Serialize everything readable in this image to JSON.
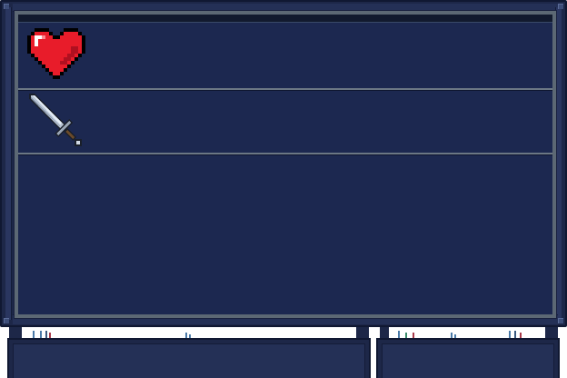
{
  "panel": {
    "rows": [
      {
        "icon": "heart-icon",
        "color": "#e81c2a"
      },
      {
        "icon": "sword-icon",
        "color": "#b8c4d4"
      },
      {
        "icon": "",
        "color": ""
      }
    ]
  },
  "colors": {
    "panel_bg": "#1c2850",
    "frame": "#1d2748",
    "border_steel": "#5c6874",
    "heart_red": "#e81c2a",
    "sword_steel": "#b8c4d4"
  },
  "slots": [
    {
      "name": "slot-left"
    },
    {
      "name": "slot-right"
    }
  ]
}
